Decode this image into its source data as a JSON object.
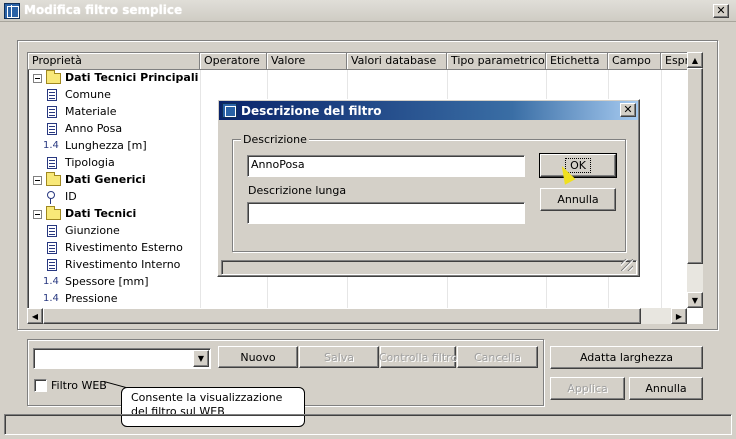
{
  "window": {
    "title": "Modifica filtro semplice",
    "close_label": "✕"
  },
  "grid": {
    "columns": [
      "Proprietà",
      "Operatore",
      "Valore",
      "Valori database",
      "Tipo parametrico",
      "Etichetta",
      "Campo",
      "Espr"
    ],
    "rows": [
      {
        "type": "group",
        "label": "Dati Tecnici Principali"
      },
      {
        "type": "text",
        "icon": "document-icon",
        "label": "Comune"
      },
      {
        "type": "text",
        "icon": "document-icon",
        "label": "Materiale"
      },
      {
        "type": "text",
        "icon": "document-icon",
        "label": "Anno Posa"
      },
      {
        "type": "number",
        "icon": "number-icon",
        "icon_text": "1.4",
        "label": "Lunghezza [m]"
      },
      {
        "type": "text",
        "icon": "document-icon",
        "label": "Tipologia"
      },
      {
        "type": "group",
        "label": "Dati Generici"
      },
      {
        "type": "key",
        "icon": "key-icon",
        "label": "ID"
      },
      {
        "type": "group",
        "label": "Dati Tecnici"
      },
      {
        "type": "text",
        "icon": "document-icon",
        "label": "Giunzione"
      },
      {
        "type": "text",
        "icon": "document-icon",
        "label": "Rivestimento Esterno"
      },
      {
        "type": "text",
        "icon": "document-icon",
        "label": "Rivestimento Interno"
      },
      {
        "type": "number",
        "icon": "number-icon",
        "icon_text": "1.4",
        "label": "Spessore [mm]"
      },
      {
        "type": "number",
        "icon": "number-icon",
        "icon_text": "1.4",
        "label": "Pressione"
      }
    ]
  },
  "scrollbar": {
    "up": "▲",
    "down": "▼",
    "left": "◀",
    "right": "▶"
  },
  "toolbar": {
    "combo_value": "",
    "combo_arrow": "▼",
    "new_label": "Nuovo",
    "save_label": "Salva",
    "check_label": "Controlla filtro",
    "delete_label": "Cancella",
    "fit_width_label": "Adatta larghezza",
    "apply_label": "Applica",
    "cancel_label": "Annulla"
  },
  "web_filter": {
    "label": "Filtro WEB",
    "checked": false,
    "tooltip": "Consente la visualizzazione del filtro sul WEB"
  },
  "dialog": {
    "title": "Descrizione del filtro",
    "close_label": "✕",
    "group_label": "Descrizione",
    "description_value": "AnnoPosa",
    "long_description_label": "Descrizione lunga",
    "long_description_value": "",
    "ok_label": "OK",
    "cancel_label": "Annulla"
  }
}
